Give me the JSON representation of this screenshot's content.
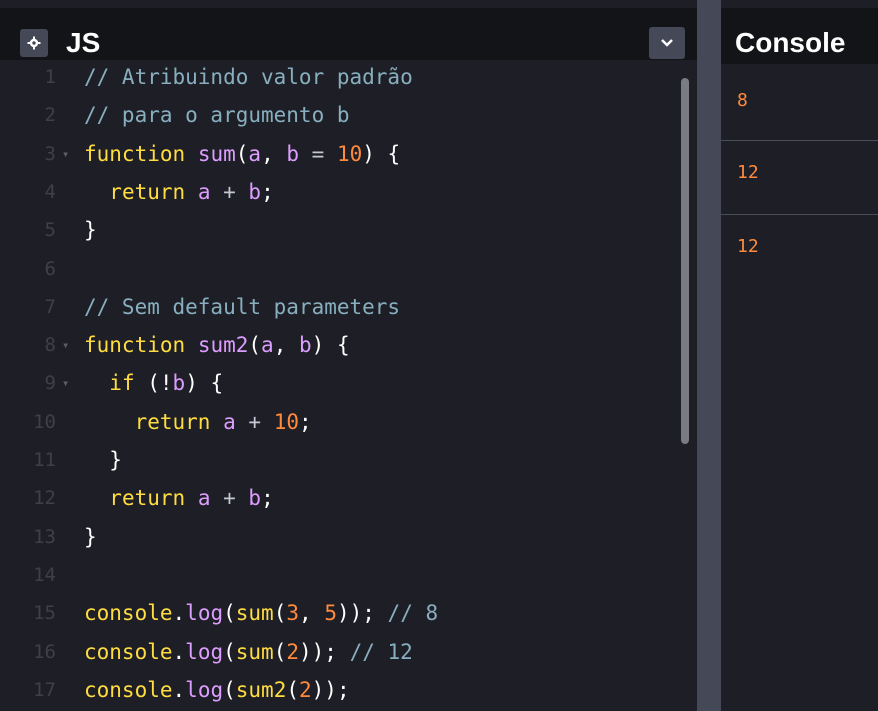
{
  "editor": {
    "title": "JS",
    "gear_icon": "gear-icon",
    "chevron_icon": "chevron-down-icon",
    "lines": [
      {
        "n": "1",
        "fold": false,
        "tokens": [
          {
            "t": "// Atribuindo valor padrão",
            "c": "cm"
          }
        ]
      },
      {
        "n": "2",
        "fold": false,
        "tokens": [
          {
            "t": "// para o argumento b",
            "c": "cm"
          }
        ]
      },
      {
        "n": "3",
        "fold": true,
        "tokens": [
          {
            "t": "function",
            "c": "kw"
          },
          {
            "t": " ",
            "c": ""
          },
          {
            "t": "sum",
            "c": "fn"
          },
          {
            "t": "(",
            "c": ""
          },
          {
            "t": "a",
            "c": "fn"
          },
          {
            "t": ", ",
            "c": ""
          },
          {
            "t": "b",
            "c": "fn"
          },
          {
            "t": " = ",
            "c": "op"
          },
          {
            "t": "10",
            "c": "num"
          },
          {
            "t": ") {",
            "c": ""
          }
        ]
      },
      {
        "n": "4",
        "fold": false,
        "tokens": [
          {
            "t": "  ",
            "c": ""
          },
          {
            "t": "return",
            "c": "kw"
          },
          {
            "t": " ",
            "c": ""
          },
          {
            "t": "a",
            "c": "fn"
          },
          {
            "t": " + ",
            "c": "op"
          },
          {
            "t": "b",
            "c": "fn"
          },
          {
            "t": ";",
            "c": ""
          }
        ]
      },
      {
        "n": "5",
        "fold": false,
        "tokens": [
          {
            "t": "}",
            "c": ""
          }
        ]
      },
      {
        "n": "6",
        "fold": false,
        "tokens": []
      },
      {
        "n": "7",
        "fold": false,
        "tokens": [
          {
            "t": "// Sem default parameters",
            "c": "cm"
          }
        ]
      },
      {
        "n": "8",
        "fold": true,
        "tokens": [
          {
            "t": "function",
            "c": "kw"
          },
          {
            "t": " ",
            "c": ""
          },
          {
            "t": "sum2",
            "c": "fn"
          },
          {
            "t": "(",
            "c": ""
          },
          {
            "t": "a",
            "c": "fn"
          },
          {
            "t": ", ",
            "c": ""
          },
          {
            "t": "b",
            "c": "fn"
          },
          {
            "t": ") {",
            "c": ""
          }
        ]
      },
      {
        "n": "9",
        "fold": true,
        "tokens": [
          {
            "t": "  ",
            "c": ""
          },
          {
            "t": "if",
            "c": "kw"
          },
          {
            "t": " (!",
            "c": ""
          },
          {
            "t": "b",
            "c": "fn"
          },
          {
            "t": ") {",
            "c": ""
          }
        ]
      },
      {
        "n": "10",
        "fold": false,
        "tokens": [
          {
            "t": "    ",
            "c": ""
          },
          {
            "t": "return",
            "c": "kw"
          },
          {
            "t": " ",
            "c": ""
          },
          {
            "t": "a",
            "c": "fn"
          },
          {
            "t": " + ",
            "c": "op"
          },
          {
            "t": "10",
            "c": "num"
          },
          {
            "t": ";",
            "c": ""
          }
        ]
      },
      {
        "n": "11",
        "fold": false,
        "tokens": [
          {
            "t": "  }",
            "c": ""
          }
        ]
      },
      {
        "n": "12",
        "fold": false,
        "tokens": [
          {
            "t": "  ",
            "c": ""
          },
          {
            "t": "return",
            "c": "kw"
          },
          {
            "t": " ",
            "c": ""
          },
          {
            "t": "a",
            "c": "fn"
          },
          {
            "t": " + ",
            "c": "op"
          },
          {
            "t": "b",
            "c": "fn"
          },
          {
            "t": ";",
            "c": ""
          }
        ]
      },
      {
        "n": "13",
        "fold": false,
        "tokens": [
          {
            "t": "}",
            "c": ""
          }
        ]
      },
      {
        "n": "14",
        "fold": false,
        "tokens": []
      },
      {
        "n": "15",
        "fold": false,
        "tokens": [
          {
            "t": "console",
            "c": "kw"
          },
          {
            "t": ".",
            "c": ""
          },
          {
            "t": "log",
            "c": "fn"
          },
          {
            "t": "(",
            "c": ""
          },
          {
            "t": "sum",
            "c": "kw"
          },
          {
            "t": "(",
            "c": ""
          },
          {
            "t": "3",
            "c": "num"
          },
          {
            "t": ", ",
            "c": ""
          },
          {
            "t": "5",
            "c": "num"
          },
          {
            "t": ")); ",
            "c": ""
          },
          {
            "t": "// 8",
            "c": "cm"
          }
        ]
      },
      {
        "n": "16",
        "fold": false,
        "tokens": [
          {
            "t": "console",
            "c": "kw"
          },
          {
            "t": ".",
            "c": ""
          },
          {
            "t": "log",
            "c": "fn"
          },
          {
            "t": "(",
            "c": ""
          },
          {
            "t": "sum",
            "c": "kw"
          },
          {
            "t": "(",
            "c": ""
          },
          {
            "t": "2",
            "c": "num"
          },
          {
            "t": ")); ",
            "c": ""
          },
          {
            "t": "// 12",
            "c": "cm"
          }
        ]
      },
      {
        "n": "17",
        "fold": false,
        "tokens": [
          {
            "t": "console",
            "c": "kw"
          },
          {
            "t": ".",
            "c": ""
          },
          {
            "t": "log",
            "c": "fn"
          },
          {
            "t": "(",
            "c": ""
          },
          {
            "t": "sum2",
            "c": "kw"
          },
          {
            "t": "(",
            "c": ""
          },
          {
            "t": "2",
            "c": "num"
          },
          {
            "t": "));",
            "c": ""
          }
        ]
      }
    ]
  },
  "console": {
    "title": "Console",
    "entries": [
      "8",
      "12",
      "12"
    ]
  },
  "colors": {
    "keyword": "#ffdd40",
    "function": "#dd9dff",
    "number": "#ff8a3c",
    "comment": "#88afbf",
    "background": "#1e1f26",
    "header": "#131417"
  }
}
